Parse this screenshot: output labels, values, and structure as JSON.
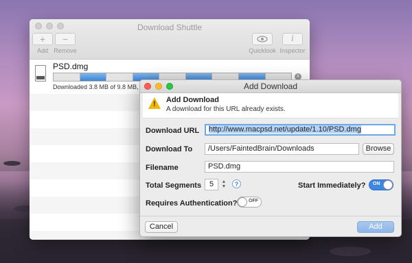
{
  "main_window": {
    "title": "Download Shuttle",
    "toolbar": {
      "add_label": "Add",
      "add_glyph": "+",
      "remove_label": "Remove",
      "remove_glyph": "−",
      "quicklook_label": "Quicklook",
      "inspector_label": "Inspector",
      "inspector_glyph": "i"
    },
    "download": {
      "filename": "PSD.dmg",
      "status": "Downloaded 3.8 MB of 9.8 MB,",
      "segments": [
        false,
        true,
        false,
        true,
        false,
        true,
        false,
        true,
        false
      ],
      "pause_glyph": "II"
    }
  },
  "dialog": {
    "title": "Add Download",
    "alert_title": "Add Download",
    "alert_message": "A download for this URL already exists.",
    "url_label": "Download URL",
    "url_value": "http://www.macpsd.net/update/1.10/PSD.dmg",
    "download_to_label": "Download To",
    "download_to_value": "/Users/FaintedBrain/Downloads",
    "browse_label": "Browse",
    "filename_label": "Filename",
    "filename_value": "PSD.dmg",
    "segments_label": "Total Segments",
    "segments_value": "5",
    "help_glyph": "?",
    "start_label": "Start Immediately?",
    "start_toggle": "ON",
    "auth_label": "Requires Authentication?",
    "auth_toggle": "OFF",
    "cancel_label": "Cancel",
    "add_label": "Add"
  }
}
